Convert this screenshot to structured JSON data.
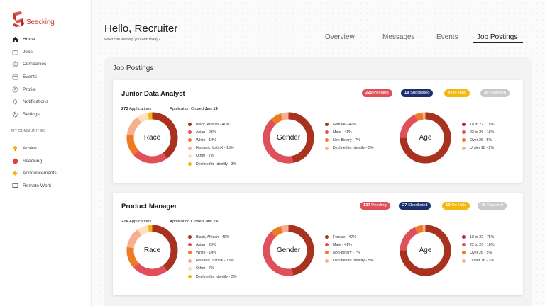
{
  "app": {
    "name": "Seecking"
  },
  "sidebar": {
    "items": [
      {
        "label": "Home",
        "icon": "home-icon"
      },
      {
        "label": "Jobs",
        "icon": "briefcase-icon"
      },
      {
        "label": "Companies",
        "icon": "building-icon"
      },
      {
        "label": "Events",
        "icon": "calendar-icon"
      },
      {
        "label": "Profile",
        "icon": "user-icon"
      },
      {
        "label": "Notifications",
        "icon": "bell-icon"
      },
      {
        "label": "Settings",
        "icon": "gear-icon"
      }
    ],
    "communities_heading": "MY COMMUNITIES",
    "communities": [
      {
        "label": "Advice",
        "icon": "lightbulb-icon"
      },
      {
        "label": "Seecking",
        "icon": "red-circle-icon"
      },
      {
        "label": "Announcements",
        "icon": "megaphone-icon"
      },
      {
        "label": "Remote Work",
        "icon": "laptop-icon"
      }
    ]
  },
  "header": {
    "greeting": "Hello, Recruiter",
    "subtitle": "What can we help you with today?",
    "tabs": [
      "Overview",
      "Messages",
      "Events",
      "Job Postings"
    ],
    "active_tab": "Job Postings"
  },
  "panel": {
    "title": "Job Postings"
  },
  "colors": {
    "dark_red": "#a8321f",
    "red": "#e0505a",
    "orange": "#ee7a24",
    "peach": "#f6b08e",
    "light_peach": "#fde0bd",
    "yellow": "#f3b70e",
    "navy": "#1d2f6f",
    "gray": "#c9c9c9"
  },
  "jobs": [
    {
      "title": "Junior Data Analyst",
      "applications_count": "273",
      "applications_label": "Applications",
      "closed_label": "Application Closed",
      "closed_date": "Jan 19",
      "badges": {
        "pending": {
          "count": "220",
          "label": "Pending"
        },
        "shortlisted": {
          "count": "19",
          "label": "Shortlisted"
        },
        "on_hold": {
          "count": "4",
          "label": "On Hold"
        },
        "rejected": {
          "count": "30",
          "label": "Rejected"
        }
      },
      "race": {
        "title": "Race",
        "items": [
          "Black, African - 40%",
          "Asian - 23%",
          "White - 14%",
          "Hispanic, LatinX - 13%",
          "Other - 7%",
          "Declined to Identify - 3%"
        ]
      },
      "gender": {
        "title": "Gender",
        "items": [
          "Female - 47%",
          "Male - 41%",
          "Non-Binary - 7%",
          "Declined to Identify - 5%"
        ]
      },
      "age": {
        "title": "Age",
        "items": [
          "18 to 22 - 75%",
          "22 to 26 - 18%",
          "Over 26 - 5%",
          "Under 18 - 2%"
        ]
      }
    },
    {
      "title": "Product Manager",
      "applications_count": "219",
      "applications_label": "Applications",
      "closed_label": "Application Closed",
      "closed_date": "Jan 19",
      "badges": {
        "pending": {
          "count": "137",
          "label": "Pending"
        },
        "shortlisted": {
          "count": "27",
          "label": "Shortlisted"
        },
        "on_hold": {
          "count": "10",
          "label": "On Hold"
        },
        "rejected": {
          "count": "45",
          "label": "Rejected"
        }
      },
      "race": {
        "title": "Race",
        "items": [
          "Black, African - 40%",
          "Asian - 23%",
          "White - 14%",
          "Hispanic, LatinX - 13%",
          "Other - 7%",
          "Declined to Identify - 3%"
        ]
      },
      "gender": {
        "title": "Gender",
        "items": [
          "Female - 47%",
          "Male - 41%",
          "Non-Binary - 7%",
          "Declined to Identify - 5%"
        ]
      },
      "age": {
        "title": "Age",
        "items": [
          "18 to 22 - 75%",
          "22 to 26 - 18%",
          "Over 26 - 5%",
          "Under 18 - 2%"
        ]
      }
    }
  ],
  "chart_data": [
    {
      "type": "pie",
      "title": "Race",
      "categories": [
        "Black, African",
        "Asian",
        "White",
        "Hispanic, LatinX",
        "Other",
        "Declined to Identify"
      ],
      "values": [
        40,
        23,
        14,
        13,
        7,
        3
      ],
      "colors": [
        "#a8321f",
        "#e0505a",
        "#ee7a24",
        "#f6b08e",
        "#fde0bd",
        "#f3b70e"
      ]
    },
    {
      "type": "pie",
      "title": "Gender",
      "categories": [
        "Female",
        "Male",
        "Non-Binary",
        "Declined to Identify"
      ],
      "values": [
        47,
        41,
        7,
        5
      ],
      "colors": [
        "#a8321f",
        "#e0505a",
        "#ee7a24",
        "#f6b08e"
      ]
    },
    {
      "type": "pie",
      "title": "Age",
      "categories": [
        "18 to 22",
        "22 to 26",
        "Over 26",
        "Under 18"
      ],
      "values": [
        75,
        18,
        5,
        2
      ],
      "colors": [
        "#a8321f",
        "#e0505a",
        "#ee7a24",
        "#f6b08e"
      ]
    }
  ]
}
